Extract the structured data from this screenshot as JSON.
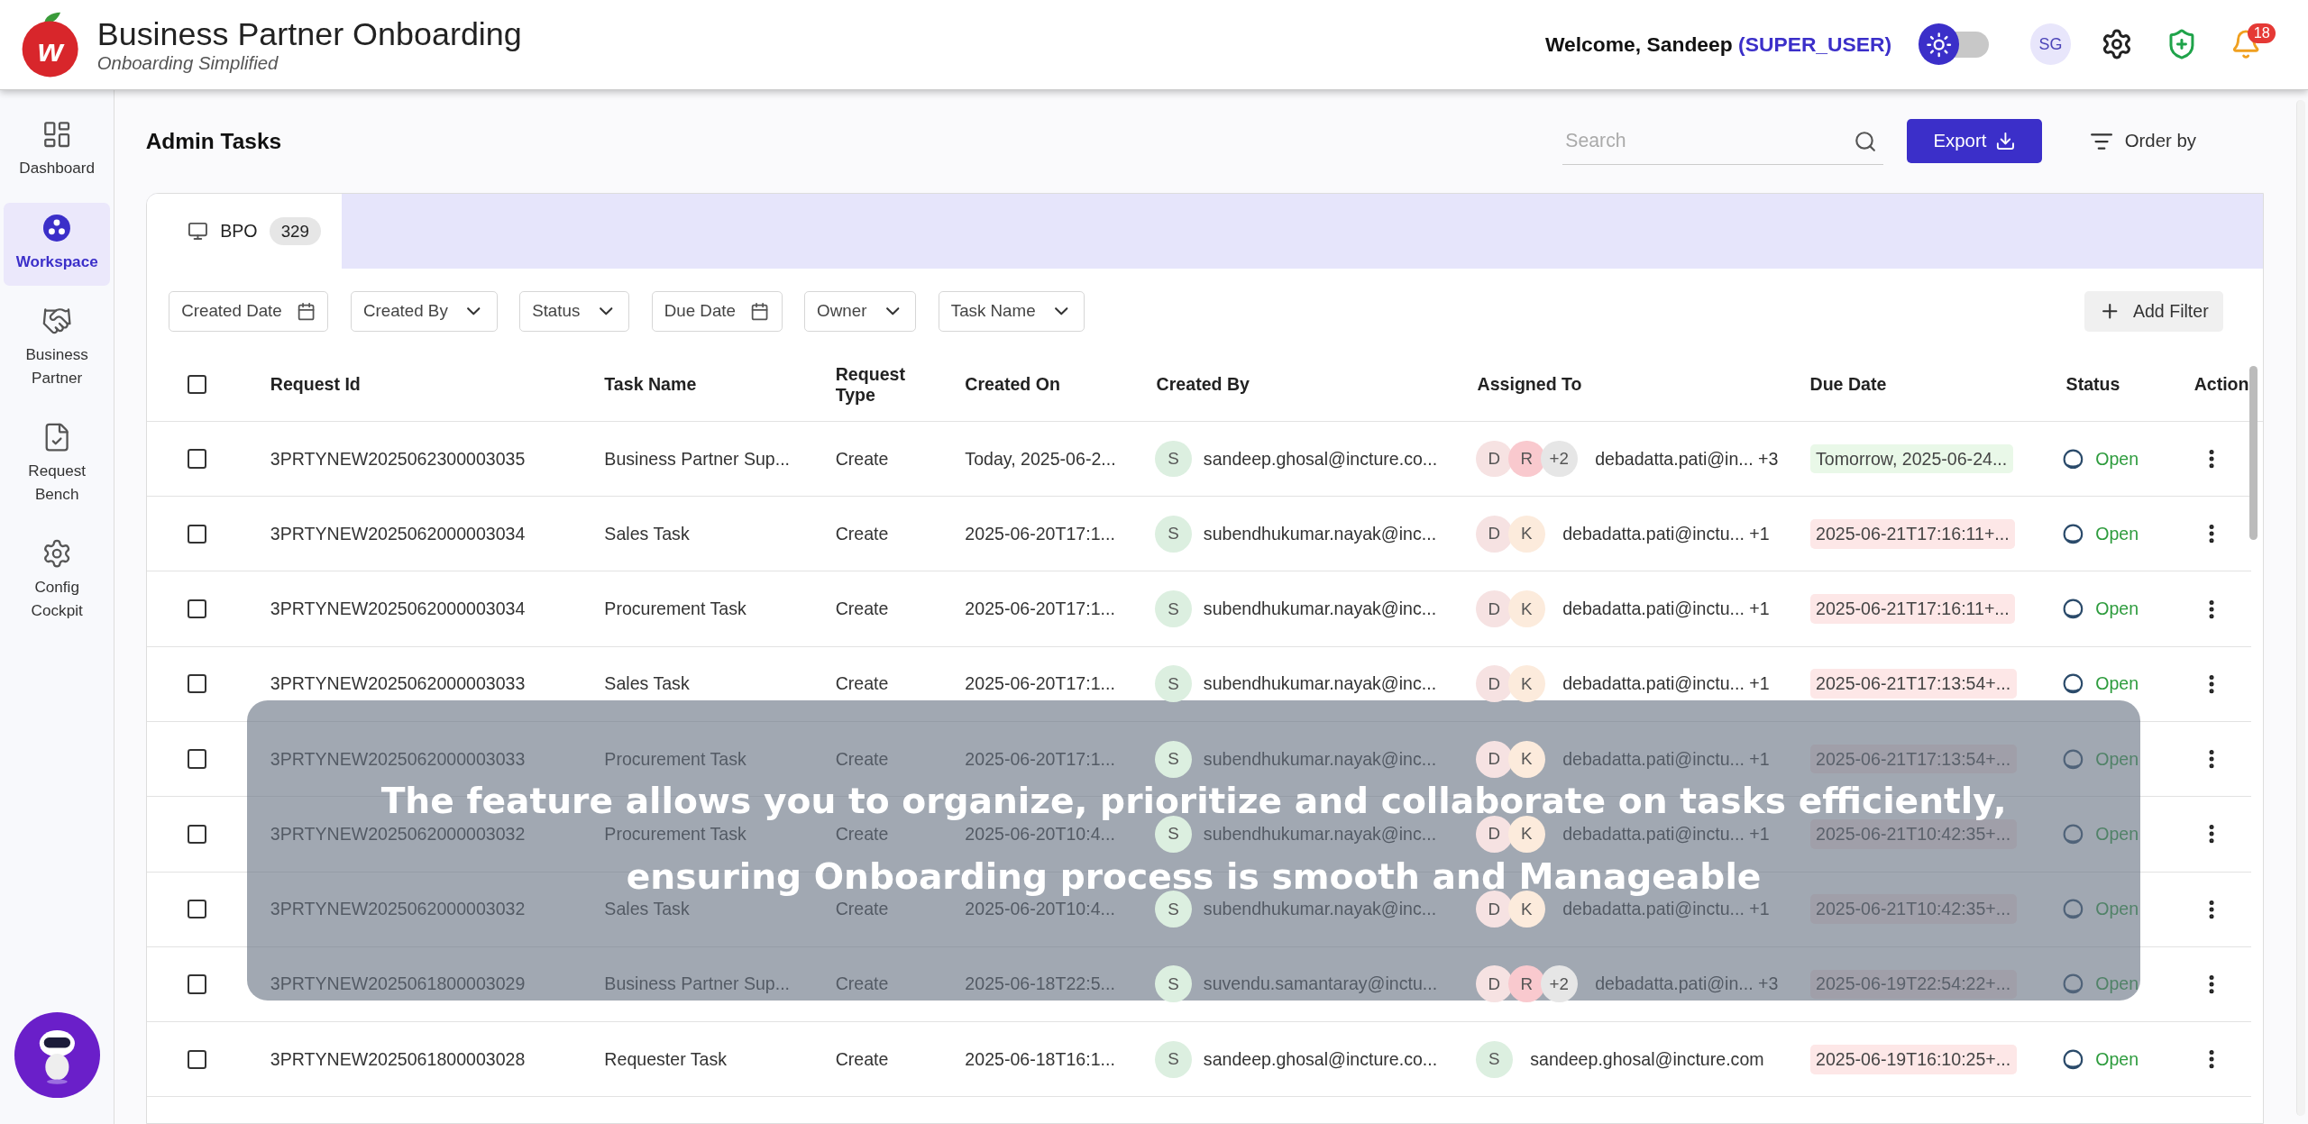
{
  "header": {
    "logo_text": "w",
    "title": "Business Partner Onboarding",
    "subtitle": "Onboarding Simplified",
    "welcome": "Welcome, Sandeep",
    "role": "(SUPER_USER)",
    "theme_toggle": {
      "on": false
    },
    "user_initials": "SG",
    "notifications": "18"
  },
  "sidebar": {
    "items": [
      {
        "label": "Dashboard",
        "selected": false
      },
      {
        "label": "Workspace",
        "selected": true
      },
      {
        "label": "Business Partner",
        "selected": false
      },
      {
        "label": "Request Bench",
        "selected": false
      },
      {
        "label": "Config Cockpit",
        "selected": false
      }
    ]
  },
  "page": {
    "title": "Admin Tasks",
    "search": {
      "placeholder": "Search"
    },
    "export_button": "Export",
    "order_by": "Order by"
  },
  "tabs": [
    {
      "label": "BPO",
      "count": "329",
      "selected": true
    }
  ],
  "filters": [
    {
      "label": "Created Date",
      "kind": "date"
    },
    {
      "label": "Created By",
      "kind": "select"
    },
    {
      "label": "Status",
      "kind": "select"
    },
    {
      "label": "Due Date",
      "kind": "date"
    },
    {
      "label": "Owner",
      "kind": "select"
    },
    {
      "label": "Task Name",
      "kind": "select"
    }
  ],
  "add_filter": "Add Filter",
  "table": {
    "select_all": {
      "checked": false
    },
    "columns": [
      "Request Id",
      "Task Name",
      "Request Type",
      "Created On",
      "Created By",
      "Assigned To",
      "Due Date",
      "Status",
      "Action"
    ],
    "rows": [
      {
        "checked": false,
        "request_id": "3PRTYNEW2025062300003035",
        "task_name": "Business Partner Sup...",
        "request_type": "Create",
        "created_on": "Today, 2025-06-2...",
        "created_by": {
          "initial": "S",
          "color": "#dcefe0",
          "email": "sandeep.ghosal@incture.co..."
        },
        "assigned_to": {
          "avatars": [
            {
              "label": "D",
              "color": "#f6e2e2"
            },
            {
              "label": "R",
              "color": "#f9c9ce"
            },
            {
              "label": "+2",
              "color": "#e6e6e6"
            }
          ],
          "text": "debadatta.pati@in... +3"
        },
        "due_date": {
          "text": "Tomorrow, 2025-06-24...",
          "kind": "upcoming"
        },
        "status": "Open"
      },
      {
        "checked": false,
        "request_id": "3PRTYNEW2025062000003034",
        "task_name": "Sales Task",
        "request_type": "Create",
        "created_on": "2025-06-20T17:1...",
        "created_by": {
          "initial": "S",
          "color": "#dcefe0",
          "email": "subendhukumar.nayak@inc..."
        },
        "assigned_to": {
          "avatars": [
            {
              "label": "D",
              "color": "#f6e2e2"
            },
            {
              "label": "K",
              "color": "#fcebdc"
            }
          ],
          "text": "debadatta.pati@inctu... +1"
        },
        "due_date": {
          "text": "2025-06-21T17:16:11+...",
          "kind": "overdue"
        },
        "status": "Open"
      },
      {
        "checked": false,
        "request_id": "3PRTYNEW2025062000003034",
        "task_name": "Procurement Task",
        "request_type": "Create",
        "created_on": "2025-06-20T17:1...",
        "created_by": {
          "initial": "S",
          "color": "#dcefe0",
          "email": "subendhukumar.nayak@inc..."
        },
        "assigned_to": {
          "avatars": [
            {
              "label": "D",
              "color": "#f6e2e2"
            },
            {
              "label": "K",
              "color": "#fcebdc"
            }
          ],
          "text": "debadatta.pati@inctu... +1"
        },
        "due_date": {
          "text": "2025-06-21T17:16:11+...",
          "kind": "overdue"
        },
        "status": "Open"
      },
      {
        "checked": false,
        "request_id": "3PRTYNEW2025062000003033",
        "task_name": "Sales Task",
        "request_type": "Create",
        "created_on": "2025-06-20T17:1...",
        "created_by": {
          "initial": "S",
          "color": "#dcefe0",
          "email": "subendhukumar.nayak@inc..."
        },
        "assigned_to": {
          "avatars": [
            {
              "label": "D",
              "color": "#f6e2e2"
            },
            {
              "label": "K",
              "color": "#fcebdc"
            }
          ],
          "text": "debadatta.pati@inctu... +1"
        },
        "due_date": {
          "text": "2025-06-21T17:13:54+...",
          "kind": "overdue"
        },
        "status": "Open"
      },
      {
        "checked": false,
        "request_id": "3PRTYNEW2025062000003033",
        "task_name": "Procurement Task",
        "request_type": "Create",
        "created_on": "2025-06-20T17:1...",
        "created_by": {
          "initial": "S",
          "color": "#dcefe0",
          "email": "subendhukumar.nayak@inc..."
        },
        "assigned_to": {
          "avatars": [
            {
              "label": "D",
              "color": "#f6e2e2"
            },
            {
              "label": "K",
              "color": "#fcebdc"
            }
          ],
          "text": "debadatta.pati@inctu... +1"
        },
        "due_date": {
          "text": "2025-06-21T17:13:54+...",
          "kind": "overdue"
        },
        "status": "Open"
      },
      {
        "checked": false,
        "request_id": "3PRTYNEW2025062000003032",
        "task_name": "Procurement Task",
        "request_type": "Create",
        "created_on": "2025-06-20T10:4...",
        "created_by": {
          "initial": "S",
          "color": "#dcefe0",
          "email": "subendhukumar.nayak@inc..."
        },
        "assigned_to": {
          "avatars": [
            {
              "label": "D",
              "color": "#f6e2e2"
            },
            {
              "label": "K",
              "color": "#fcebdc"
            }
          ],
          "text": "debadatta.pati@inctu... +1"
        },
        "due_date": {
          "text": "2025-06-21T10:42:35+...",
          "kind": "overdue"
        },
        "status": "Open"
      },
      {
        "checked": false,
        "request_id": "3PRTYNEW2025062000003032",
        "task_name": "Sales Task",
        "request_type": "Create",
        "created_on": "2025-06-20T10:4...",
        "created_by": {
          "initial": "S",
          "color": "#dcefe0",
          "email": "subendhukumar.nayak@inc..."
        },
        "assigned_to": {
          "avatars": [
            {
              "label": "D",
              "color": "#f6e2e2"
            },
            {
              "label": "K",
              "color": "#fcebdc"
            }
          ],
          "text": "debadatta.pati@inctu... +1"
        },
        "due_date": {
          "text": "2025-06-21T10:42:35+...",
          "kind": "overdue"
        },
        "status": "Open"
      },
      {
        "checked": false,
        "request_id": "3PRTYNEW2025061800003029",
        "task_name": "Business Partner Sup...",
        "request_type": "Create",
        "created_on": "2025-06-18T22:5...",
        "created_by": {
          "initial": "S",
          "color": "#dcefe0",
          "email": "suvendu.samantaray@inctu..."
        },
        "assigned_to": {
          "avatars": [
            {
              "label": "D",
              "color": "#f6e2e2"
            },
            {
              "label": "R",
              "color": "#f9c9ce"
            },
            {
              "label": "+2",
              "color": "#e6e6e6"
            }
          ],
          "text": "debadatta.pati@in... +3"
        },
        "due_date": {
          "text": "2025-06-19T22:54:22+...",
          "kind": "overdue"
        },
        "status": "Open"
      },
      {
        "checked": false,
        "request_id": "3PRTYNEW2025061800003028",
        "task_name": "Requester Task",
        "request_type": "Create",
        "created_on": "2025-06-18T16:1...",
        "created_by": {
          "initial": "S",
          "color": "#dcefe0",
          "email": "sandeep.ghosal@incture.co..."
        },
        "assigned_to": {
          "avatars": [
            {
              "label": "S",
              "color": "#dcefe0"
            }
          ],
          "text": "sandeep.ghosal@incture.com"
        },
        "due_date": {
          "text": "2025-06-19T16:10:25+...",
          "kind": "overdue"
        },
        "status": "Open"
      }
    ]
  },
  "banner": {
    "lines": [
      "The feature allows you to organize, prioritize and collaborate on tasks efficiently,",
      "ensuring Onboarding process is smooth and Manageable"
    ]
  }
}
